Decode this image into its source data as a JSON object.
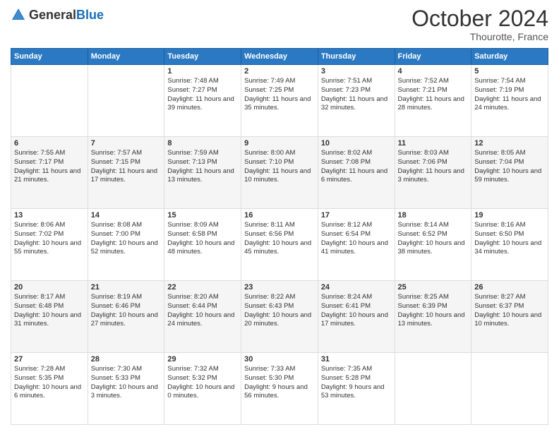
{
  "header": {
    "logo_general": "General",
    "logo_blue": "Blue",
    "month_title": "October 2024",
    "location": "Thourotte, France"
  },
  "weekdays": [
    "Sunday",
    "Monday",
    "Tuesday",
    "Wednesday",
    "Thursday",
    "Friday",
    "Saturday"
  ],
  "weeks": [
    [
      {
        "day": "",
        "info": ""
      },
      {
        "day": "",
        "info": ""
      },
      {
        "day": "1",
        "info": "Sunrise: 7:48 AM\nSunset: 7:27 PM\nDaylight: 11 hours and 39 minutes."
      },
      {
        "day": "2",
        "info": "Sunrise: 7:49 AM\nSunset: 7:25 PM\nDaylight: 11 hours and 35 minutes."
      },
      {
        "day": "3",
        "info": "Sunrise: 7:51 AM\nSunset: 7:23 PM\nDaylight: 11 hours and 32 minutes."
      },
      {
        "day": "4",
        "info": "Sunrise: 7:52 AM\nSunset: 7:21 PM\nDaylight: 11 hours and 28 minutes."
      },
      {
        "day": "5",
        "info": "Sunrise: 7:54 AM\nSunset: 7:19 PM\nDaylight: 11 hours and 24 minutes."
      }
    ],
    [
      {
        "day": "6",
        "info": "Sunrise: 7:55 AM\nSunset: 7:17 PM\nDaylight: 11 hours and 21 minutes."
      },
      {
        "day": "7",
        "info": "Sunrise: 7:57 AM\nSunset: 7:15 PM\nDaylight: 11 hours and 17 minutes."
      },
      {
        "day": "8",
        "info": "Sunrise: 7:59 AM\nSunset: 7:13 PM\nDaylight: 11 hours and 13 minutes."
      },
      {
        "day": "9",
        "info": "Sunrise: 8:00 AM\nSunset: 7:10 PM\nDaylight: 11 hours and 10 minutes."
      },
      {
        "day": "10",
        "info": "Sunrise: 8:02 AM\nSunset: 7:08 PM\nDaylight: 11 hours and 6 minutes."
      },
      {
        "day": "11",
        "info": "Sunrise: 8:03 AM\nSunset: 7:06 PM\nDaylight: 11 hours and 3 minutes."
      },
      {
        "day": "12",
        "info": "Sunrise: 8:05 AM\nSunset: 7:04 PM\nDaylight: 10 hours and 59 minutes."
      }
    ],
    [
      {
        "day": "13",
        "info": "Sunrise: 8:06 AM\nSunset: 7:02 PM\nDaylight: 10 hours and 55 minutes."
      },
      {
        "day": "14",
        "info": "Sunrise: 8:08 AM\nSunset: 7:00 PM\nDaylight: 10 hours and 52 minutes."
      },
      {
        "day": "15",
        "info": "Sunrise: 8:09 AM\nSunset: 6:58 PM\nDaylight: 10 hours and 48 minutes."
      },
      {
        "day": "16",
        "info": "Sunrise: 8:11 AM\nSunset: 6:56 PM\nDaylight: 10 hours and 45 minutes."
      },
      {
        "day": "17",
        "info": "Sunrise: 8:12 AM\nSunset: 6:54 PM\nDaylight: 10 hours and 41 minutes."
      },
      {
        "day": "18",
        "info": "Sunrise: 8:14 AM\nSunset: 6:52 PM\nDaylight: 10 hours and 38 minutes."
      },
      {
        "day": "19",
        "info": "Sunrise: 8:16 AM\nSunset: 6:50 PM\nDaylight: 10 hours and 34 minutes."
      }
    ],
    [
      {
        "day": "20",
        "info": "Sunrise: 8:17 AM\nSunset: 6:48 PM\nDaylight: 10 hours and 31 minutes."
      },
      {
        "day": "21",
        "info": "Sunrise: 8:19 AM\nSunset: 6:46 PM\nDaylight: 10 hours and 27 minutes."
      },
      {
        "day": "22",
        "info": "Sunrise: 8:20 AM\nSunset: 6:44 PM\nDaylight: 10 hours and 24 minutes."
      },
      {
        "day": "23",
        "info": "Sunrise: 8:22 AM\nSunset: 6:43 PM\nDaylight: 10 hours and 20 minutes."
      },
      {
        "day": "24",
        "info": "Sunrise: 8:24 AM\nSunset: 6:41 PM\nDaylight: 10 hours and 17 minutes."
      },
      {
        "day": "25",
        "info": "Sunrise: 8:25 AM\nSunset: 6:39 PM\nDaylight: 10 hours and 13 minutes."
      },
      {
        "day": "26",
        "info": "Sunrise: 8:27 AM\nSunset: 6:37 PM\nDaylight: 10 hours and 10 minutes."
      }
    ],
    [
      {
        "day": "27",
        "info": "Sunrise: 7:28 AM\nSunset: 5:35 PM\nDaylight: 10 hours and 6 minutes."
      },
      {
        "day": "28",
        "info": "Sunrise: 7:30 AM\nSunset: 5:33 PM\nDaylight: 10 hours and 3 minutes."
      },
      {
        "day": "29",
        "info": "Sunrise: 7:32 AM\nSunset: 5:32 PM\nDaylight: 10 hours and 0 minutes."
      },
      {
        "day": "30",
        "info": "Sunrise: 7:33 AM\nSunset: 5:30 PM\nDaylight: 9 hours and 56 minutes."
      },
      {
        "day": "31",
        "info": "Sunrise: 7:35 AM\nSunset: 5:28 PM\nDaylight: 9 hours and 53 minutes."
      },
      {
        "day": "",
        "info": ""
      },
      {
        "day": "",
        "info": ""
      }
    ]
  ]
}
